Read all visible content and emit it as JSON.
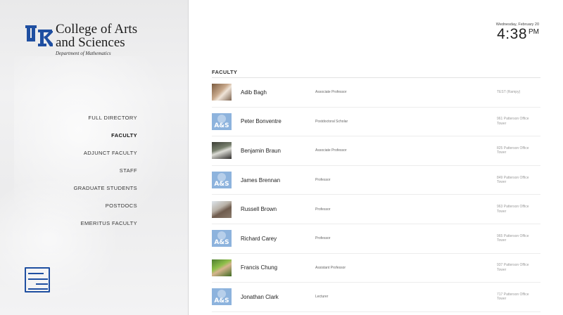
{
  "brand": {
    "title": "College of Arts\nand Sciences",
    "subtitle": "Department of Mathematics",
    "logo_color": "#1f4fa1"
  },
  "nav": {
    "items": [
      {
        "label": "FULL DIRECTORY",
        "active": false
      },
      {
        "label": "FACULTY",
        "active": true
      },
      {
        "label": "ADJUNCT FACULTY",
        "active": false
      },
      {
        "label": "STAFF",
        "active": false
      },
      {
        "label": "GRADUATE STUDENTS",
        "active": false
      },
      {
        "label": "POSTDOCS",
        "active": false
      },
      {
        "label": "EMERITUS FACULTY",
        "active": false
      }
    ]
  },
  "clock": {
    "date": "Wednesday, February 20",
    "time": "4:38",
    "ampm": "PM"
  },
  "section": {
    "title": "FACULTY"
  },
  "people": [
    {
      "name": "Adib Bagh",
      "title": "Associate Professor",
      "office": "TEST (Rampy)",
      "avatar": "photo1"
    },
    {
      "name": "Peter Bonventre",
      "title": "Postdoctoral Scholar",
      "office": "961 Patterson Office Tower",
      "avatar": "as"
    },
    {
      "name": "Benjamin Braun",
      "title": "Associate Professor",
      "office": "825 Patterson Office Tower",
      "avatar": "photo2"
    },
    {
      "name": "James Brennan",
      "title": "Professor",
      "office": "849 Patterson Office Tower",
      "avatar": "as"
    },
    {
      "name": "Russell Brown",
      "title": "Professor",
      "office": "963 Patterson Office Tower",
      "avatar": "photo3"
    },
    {
      "name": "Richard Carey",
      "title": "Professor",
      "office": "965 Patterson Office Tower",
      "avatar": "as"
    },
    {
      "name": "Francis Chung",
      "title": "Assistant Professor",
      "office": "937 Patterson Office Tower",
      "avatar": "photo4"
    },
    {
      "name": "Jonathan Clark",
      "title": "Lecturer",
      "office": "717 Patterson Office Tower",
      "avatar": "as"
    }
  ],
  "avatar_placeholder_text": "A&S"
}
